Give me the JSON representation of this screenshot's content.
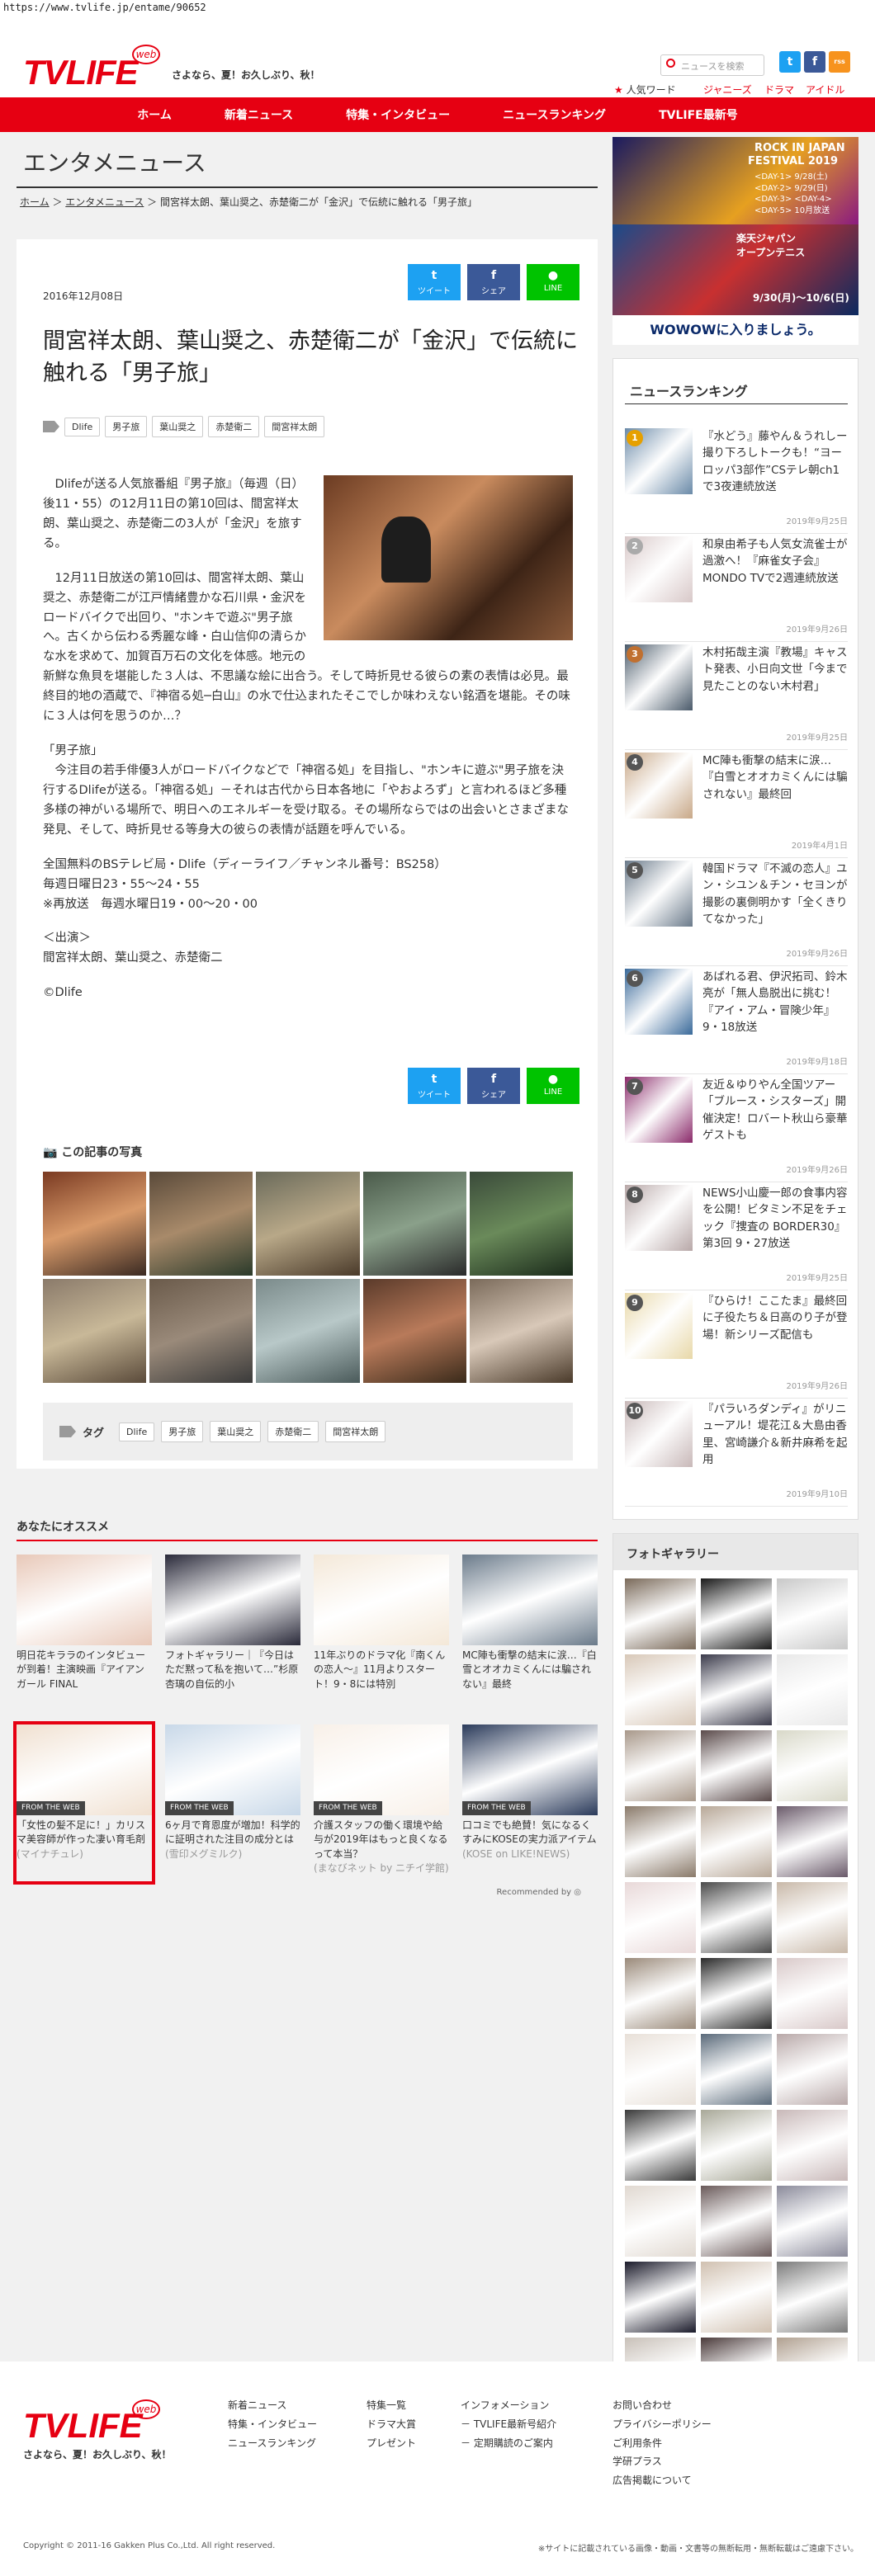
{
  "url": "https://www.tvlife.jp/entame/90652",
  "header": {
    "logo": "TVLIFE",
    "logo_badge": "web",
    "tagline": "さよなら、夏！お久しぶり、秋！",
    "search_placeholder": "ニュースを検索",
    "twitter": "t",
    "facebook": "f",
    "rss": "rss",
    "popular_label": "人気ワード",
    "popular_words": [
      "ジャニーズ",
      "ドラマ",
      "アイドル"
    ]
  },
  "nav": [
    "ホーム",
    "新着ニュース",
    "特集・インタビュー",
    "ニュースランキング",
    "TVLIFE最新号"
  ],
  "page_title": "エンタメニュース",
  "breadcrumb": {
    "home": "ホーム",
    "section": "エンタメニュース",
    "current": "間宮祥太朗、葉山奨之、赤楚衛二が「金沢」で伝統に触れる「男子旅」"
  },
  "share": {
    "tweet": "ツイート",
    "share": "シェア",
    "line": "LINE"
  },
  "article": {
    "date": "2016年12月08日",
    "title": "間宮祥太朗、葉山奨之、赤楚衛二が「金沢」で伝統に触れる「男子旅」",
    "tags": [
      "Dlife",
      "男子旅",
      "葉山奨之",
      "赤楚衛二",
      "間宮祥太朗"
    ],
    "paragraphs": [
      "　Dlifeが送る人気旅番組『男子旅』（毎週（日）後11・55）の12月11日の第10回は、間宮祥太朗、葉山奨之、赤楚衛二の3人が「金沢」を旅する。",
      "　12月11日放送の第10回は、間宮祥太朗、葉山奨之、赤楚衛二が江戸情緒豊かな石川県・金沢をロードバイクで出回り、\"ホンキで遊ぶ\"男子旅へ。古くから伝わる秀麗な峰・白山信仰の清らかな水を求めて、加賀百万石の文化を体感。地元の新鮮な魚貝を堪能した３人は、不思議な絵に出合う。そして時折見せる彼らの素の表情は必見。最終目的地の酒蔵で、『神宿る処─白山』の水で仕込まれたそこでしか味わえない銘酒を堪能。その味に３人は何を思うのか…？",
      "「男子旅」\n　今注目の若手俳優3人がロードバイクなどで「神宿る処」を目指し、\"ホンキに遊ぶ\"男子旅を決行するDlifeが送る。「神宿る処」－それは古代から日本各地に「やおよろず」と言われるほど多種多様の神がいる場所で、明日へのエネルギーを受け取る。その場所ならではの出会いとさまざまな発見、そして、時折見せる等身大の彼らの表情が話題を呼んでいる。",
      "全国無料のBSテレビ局・Dlife（ディーライフ／チャンネル番号：BS258）\n毎週日曜日23・55～24・55\n※再放送　毎週水曜日19・00～20・00",
      "＜出演＞\n間宮祥太朗、葉山奨之、赤楚衛二",
      "©Dlife"
    ],
    "photos_title": "この記事の写真",
    "tag_label": "タグ"
  },
  "ad": {
    "line1": "ROCK IN JAPAN",
    "line2": "FESTIVAL 2019",
    "days": [
      "<DAY-1> 9/28(土)",
      "<DAY-2> 9/29(日)",
      "<DAY-3> <DAY-4>",
      "<DAY-5> 10月放送"
    ],
    "tennis": "楽天ジャパン\nオープンテニス",
    "tennis_dates": "9/30(月)～10/6(日)",
    "cta": "WOWOWに入りましょう。"
  },
  "ranking": {
    "title": "ニュースランキング",
    "items": [
      {
        "num": "1",
        "text": "『水どう』藤やん＆うれしー撮り下ろしトークも！“ヨーロッパ3部作”CSテレ朝ch1で3夜連続放送",
        "date": "2019年9月25日"
      },
      {
        "num": "2",
        "text": "和泉由希子も人気女流雀士が過激へ！『麻雀女子会』MONDO TVで2週連続放送",
        "date": "2019年9月26日"
      },
      {
        "num": "3",
        "text": "木村拓哉主演『教場』キャスト発表、小日向文世「今まで見たことのない木村君」",
        "date": "2019年9月25日"
      },
      {
        "num": "4",
        "text": "MC陣も衝撃の結末に涙…『白雪とオオカミくんには騙されない』最終回",
        "date": "2019年4月1日"
      },
      {
        "num": "5",
        "text": "韓国ドラマ『不滅の恋人』ユン・シユン＆チン・セヨンが撮影の裏側明かす「全くきりてなかった」",
        "date": "2019年9月26日"
      },
      {
        "num": "6",
        "text": "あばれる君、伊沢拓司、鈴木亮が「無人島脱出に挑む！『アイ・アム・冒険少年』9・18放送",
        "date": "2019年9月18日"
      },
      {
        "num": "7",
        "text": "友近＆ゆりやん全国ツアー「ブルース・シスターズ」開催決定！ロバート秋山ら豪華ゲストも",
        "date": "2019年9月26日"
      },
      {
        "num": "8",
        "text": "NEWS小山慶一郎の食事内容を公開！ビタミン不足をチェック『捜査の BORDER30』第3回 9・27放送",
        "date": "2019年9月25日"
      },
      {
        "num": "9",
        "text": "『ひらけ！ここたま』最終回に子役たち＆日高のり子が登場！新シリーズ配信も",
        "date": "2019年9月26日"
      },
      {
        "num": "10",
        "text": "『パラいろダンディ』がリニューアル！堤花江＆大島由香里、宮崎謙介＆新井麻希を起用",
        "date": "2019年9月10日"
      }
    ]
  },
  "recommend": {
    "title": "あなたにオススメ",
    "items": [
      {
        "text": "明日花キララのインタビューが到着！主演映画『アイアンガール FINAL",
        "source": "",
        "web": ""
      },
      {
        "text": "フォトギャラリー｜『今日はただ黙って私を抱いて…”杉原杏璃の自伝的小",
        "source": "",
        "web": ""
      },
      {
        "text": "11年ぶりのドラマ化『南くんの恋人～』11月よりスタート！9・8には特別",
        "source": "",
        "web": ""
      },
      {
        "text": "MC陣も衝撃の結末に涙…『白雪とオオカミくんには騙されない』最終",
        "source": "",
        "web": ""
      },
      {
        "text": "「女性の髪不足に！」カリスマ美容師が作った凄い育毛剤",
        "source": "(マイナチュレ)",
        "web": "FROM THE WEB"
      },
      {
        "text": "6ヶ月で育恩度が増加！科学的に証明された注目の成分とは",
        "source": "(雪印メグミルク)",
        "web": "FROM THE WEB"
      },
      {
        "text": "介護スタッフの働く環境や給与が2019年はもっと良くなるって本当？",
        "source": "(まなびネット by ニチイ学館)",
        "web": "FROM THE WEB"
      },
      {
        "text": "口コミでも絶賛！気になるくすみにKOSEの実力派アイテム",
        "source": "(KOSE on LIKE!NEWS)",
        "web": "FROM THE WEB"
      }
    ],
    "recommended_by": "Recommended by"
  },
  "gallery": {
    "title": "フォトギャラリー"
  },
  "footer": {
    "logo": "TVLIFE",
    "tagline": "さよなら、夏！お久しぶり、秋！",
    "col1": [
      "新着ニュース",
      "特集・インタビュー",
      "ニュースランキング"
    ],
    "col2": [
      "特集一覧",
      "ドラマ大賞",
      "プレゼント"
    ],
    "col3": [
      "インフォメーション",
      "－ TVLIFE最新号紹介",
      "－ 定期購読のご案内"
    ],
    "col4": [
      "お問い合わせ",
      "プライバシーポリシー",
      "ご利用条件",
      "学研プラス",
      "広告掲載について"
    ],
    "copyright": "Copyright © 2011-16 Gakken Plus Co.,Ltd. All right reserved.",
    "note": "※サイトに記載されている画像・動画・文書等の無断転用・無断転載はご遠慮下さい。"
  },
  "colors": {
    "brand": "#e60012",
    "twitter": "#1da1f2",
    "facebook": "#3b5998",
    "line": "#00c300"
  }
}
